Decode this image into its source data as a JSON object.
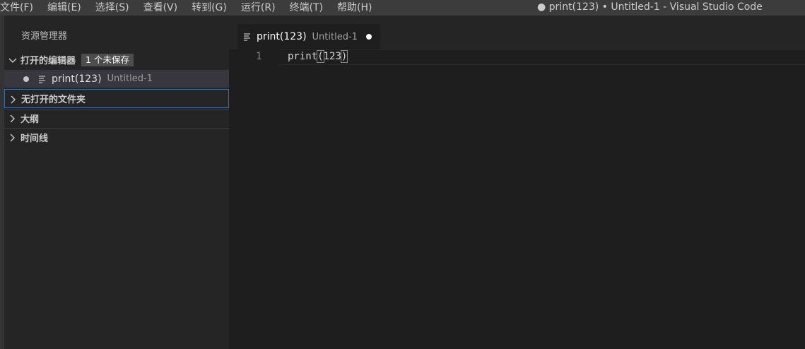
{
  "menu": {
    "items": [
      "文件(F)",
      "编辑(E)",
      "选择(S)",
      "查看(V)",
      "转到(G)",
      "运行(R)",
      "终端(T)",
      "帮助(H)"
    ]
  },
  "window": {
    "title": "● print(123) • Untitled-1 - Visual Studio Code"
  },
  "sidebar": {
    "title": "资源管理器",
    "open_editors": {
      "label": "打开的编辑器",
      "badge": "1 个未保存",
      "items": [
        {
          "name": "print(123)",
          "description": "Untitled-1",
          "icon": "file-lines-icon",
          "dirty": true
        }
      ]
    },
    "sections": {
      "no_folder": "无打开的文件夹",
      "outline": "大纲",
      "timeline": "时间线"
    }
  },
  "editor": {
    "tab": {
      "name": "print(123)",
      "description": "Untitled-1",
      "icon": "file-lines-icon",
      "dirty": true
    },
    "lines": [
      {
        "number": "1",
        "prefix": "print",
        "open_bracket": "(",
        "content": "123",
        "close_bracket": ")"
      }
    ]
  },
  "colors": {
    "titlebar": "#3c3c3c",
    "sidebar": "#252526",
    "editor": "#1e1e1e",
    "selection_row": "#37373d",
    "focus_border": "#3a6ea5"
  }
}
